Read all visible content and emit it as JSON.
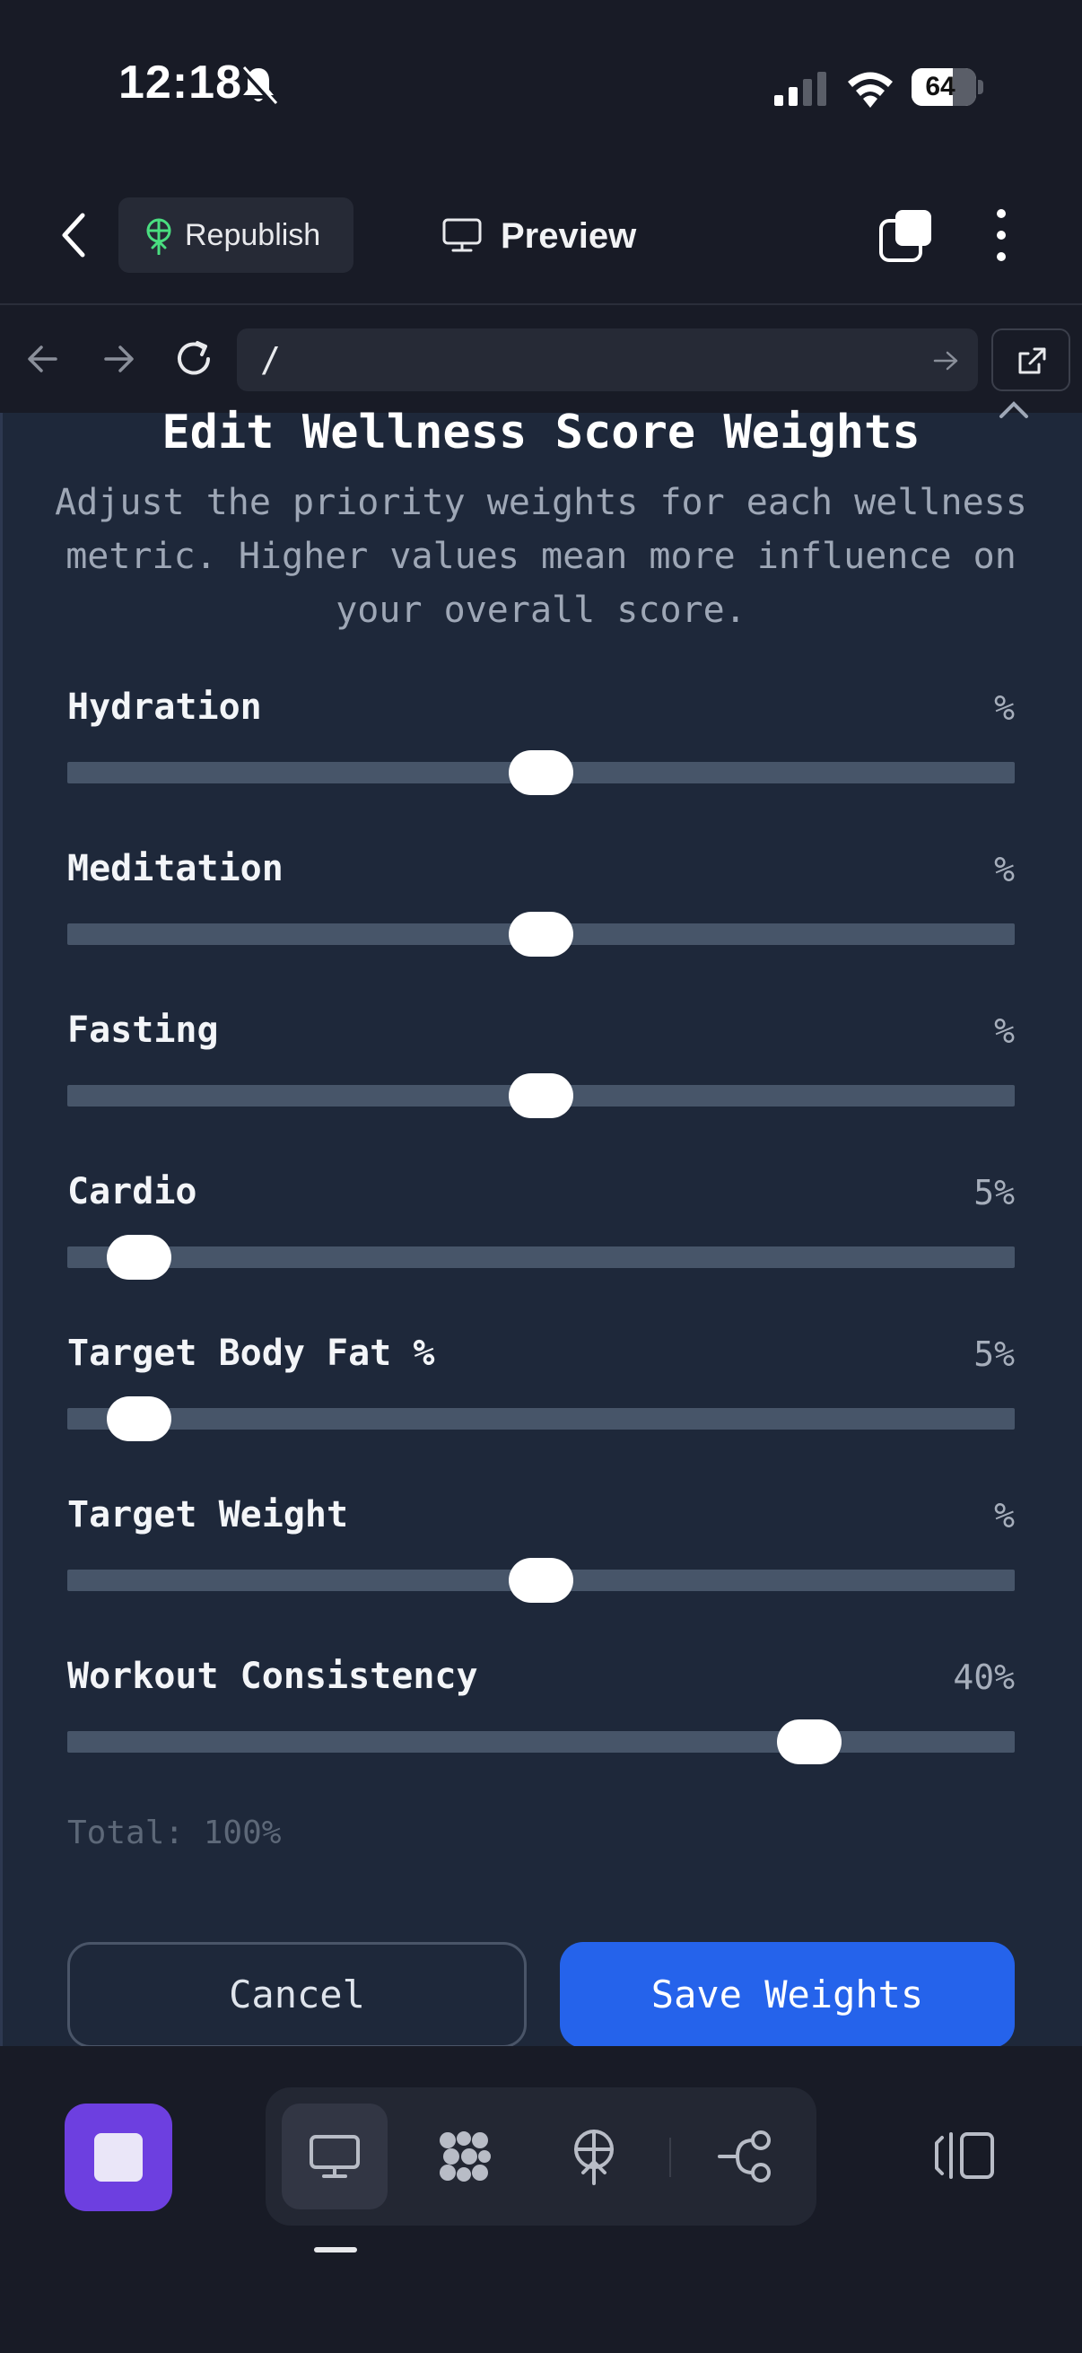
{
  "status_bar": {
    "time": "12:18",
    "battery": "64",
    "battery_level": 0.64
  },
  "app_bar": {
    "republish_label": "Republish",
    "preview_label": "Preview"
  },
  "browser": {
    "url": "/"
  },
  "modal": {
    "title": "Edit Wellness Score Weights",
    "description": "Adjust the priority weights for each wellness metric. Higher values mean more influence on your overall score.",
    "metrics": [
      {
        "label": "Hydration",
        "value": "%",
        "slider_level": 0.5
      },
      {
        "label": "Meditation",
        "value": "%",
        "slider_level": 0.5
      },
      {
        "label": "Fasting",
        "value": "%",
        "slider_level": 0.5
      },
      {
        "label": "Cardio",
        "value": "5%",
        "slider_level": 0.05
      },
      {
        "label": "Target Body Fat %",
        "value": "5%",
        "slider_level": 0.05
      },
      {
        "label": "Target Weight",
        "value": "%",
        "slider_level": 0.5
      },
      {
        "label": "Workout Consistency",
        "value": "40%",
        "slider_level": 0.8
      }
    ],
    "total": "Total: 100%",
    "cancel_label": "Cancel",
    "save_label": "Save Weights"
  },
  "colors": {
    "accent": "#2563eb",
    "panel": "#1e283a",
    "track": "#475569",
    "app_icon": "#6d3fe0"
  }
}
